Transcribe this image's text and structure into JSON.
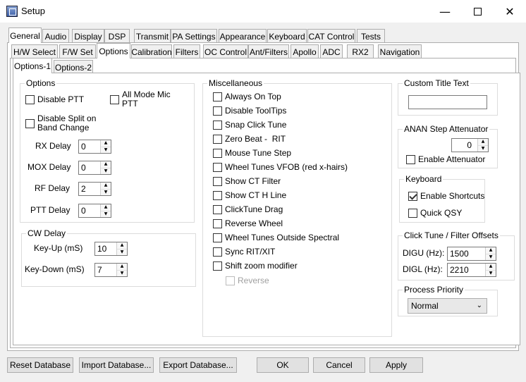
{
  "window": {
    "title": "Setup",
    "min_glyph": "—",
    "close_glyph": "✕"
  },
  "top_tabs": [
    "General",
    "Audio",
    "Display",
    "DSP",
    "Transmit",
    "PA Settings",
    "Appearance",
    "Keyboard",
    "CAT Control",
    "Tests"
  ],
  "sub_tabs": [
    "H/W Select",
    "F/W Set",
    "Options",
    "Calibration",
    "Filters",
    "OC Control",
    "Ant/Filters",
    "Apollo",
    "ADC",
    "RX2",
    "Navigation"
  ],
  "inner_tabs": [
    "Options-1",
    "Options-2"
  ],
  "options_group": {
    "title": "Options",
    "disable_ptt": "Disable PTT",
    "all_mode_mic_ptt": "All Mode Mic PTT",
    "disable_split": "Disable Split on Band Change",
    "rx_delay_label": "RX Delay",
    "rx_delay_value": "0",
    "mox_delay_label": "MOX Delay",
    "mox_delay_value": "0",
    "rf_delay_label": "RF Delay",
    "rf_delay_value": "2",
    "ptt_delay_label": "PTT Delay",
    "ptt_delay_value": "0"
  },
  "cw_delay": {
    "title": "CW Delay",
    "key_up_label": "Key-Up (mS)",
    "key_up_value": "10",
    "key_down_label": "Key-Down (mS)",
    "key_down_value": "7"
  },
  "misc": {
    "title": "Miscellaneous",
    "items": [
      {
        "label": "Always On Top",
        "checked": false,
        "disabled": false
      },
      {
        "label": "Disable ToolTips",
        "checked": false,
        "disabled": false
      },
      {
        "label": "Snap Click Tune",
        "checked": false,
        "disabled": false
      },
      {
        "label": "Zero Beat -  RIT",
        "checked": false,
        "disabled": false
      },
      {
        "label": "Mouse Tune Step",
        "checked": false,
        "disabled": false
      },
      {
        "label": "Wheel Tunes VFOB (red x-hairs)",
        "checked": false,
        "disabled": false
      },
      {
        "label": "Show CT Filter",
        "checked": false,
        "disabled": false
      },
      {
        "label": "Show CT H Line",
        "checked": false,
        "disabled": false
      },
      {
        "label": "ClickTune Drag",
        "checked": false,
        "disabled": false
      },
      {
        "label": "Reverse Wheel",
        "checked": false,
        "disabled": false
      },
      {
        "label": "Wheel Tunes Outside Spectral",
        "checked": false,
        "disabled": false
      },
      {
        "label": "Sync RIT/XIT",
        "checked": false,
        "disabled": false
      },
      {
        "label": "Shift zoom modifier",
        "checked": false,
        "disabled": false
      },
      {
        "label": "Reverse",
        "checked": false,
        "disabled": true
      }
    ]
  },
  "custom_title": {
    "title": "Custom Title Text",
    "value": ""
  },
  "anan_step": {
    "title": "ANAN Step Attenuator",
    "value": "0",
    "enable_label": "Enable Attenuator"
  },
  "keyboard": {
    "title": "Keyboard",
    "enable_shortcuts": "Enable Shortcuts",
    "quick_qsy": "Quick QSY"
  },
  "click_tune": {
    "title": "Click Tune / Filter Offsets",
    "digu_label": "DIGU (Hz):",
    "digu_value": "1500",
    "digl_label": "DIGL (Hz):",
    "digl_value": "2210"
  },
  "process_priority": {
    "title": "Process Priority",
    "value": "Normal"
  },
  "buttons": {
    "reset_db": "Reset Database",
    "import_db": "Import Database...",
    "export_db": "Export Database...",
    "ok": "OK",
    "cancel": "Cancel",
    "apply": "Apply"
  },
  "colors": {
    "window_bg": "#f0f0f0",
    "panel_bg": "#ffffff",
    "border": "#adadad"
  }
}
